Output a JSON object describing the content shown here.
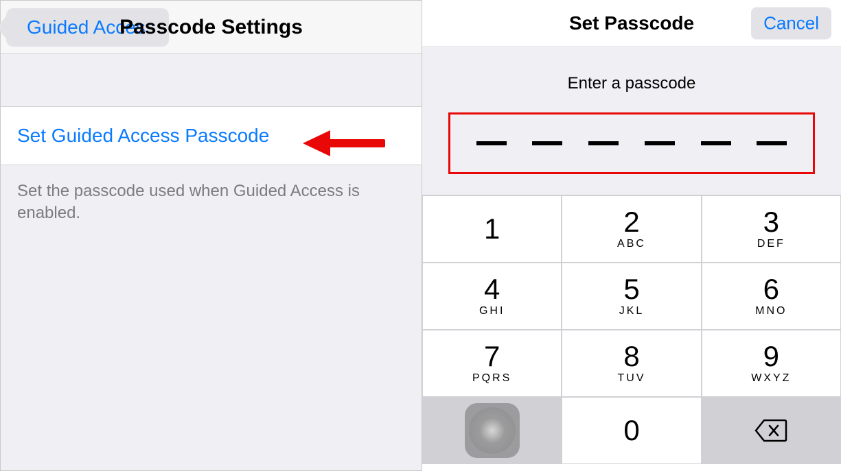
{
  "left": {
    "back_label": "Guided Access",
    "title": "Passcode Settings",
    "row_label": "Set Guided Access Passcode",
    "footer": "Set the passcode used when Guided Access is enabled."
  },
  "right": {
    "title": "Set Passcode",
    "cancel": "Cancel",
    "prompt": "Enter a passcode",
    "digits_count": 6,
    "keypad": [
      {
        "num": "1",
        "sub": ""
      },
      {
        "num": "2",
        "sub": "ABC"
      },
      {
        "num": "3",
        "sub": "DEF"
      },
      {
        "num": "4",
        "sub": "GHI"
      },
      {
        "num": "5",
        "sub": "JKL"
      },
      {
        "num": "6",
        "sub": "MNO"
      },
      {
        "num": "7",
        "sub": "PQRS"
      },
      {
        "num": "8",
        "sub": "TUV"
      },
      {
        "num": "9",
        "sub": "WXYZ"
      },
      {
        "num": "",
        "sub": "",
        "blank": true
      },
      {
        "num": "0",
        "sub": ""
      },
      {
        "num": "",
        "sub": "",
        "delete": true
      }
    ]
  },
  "annotation": {
    "arrow_color": "#e80808",
    "highlight_color": "#e80808"
  }
}
